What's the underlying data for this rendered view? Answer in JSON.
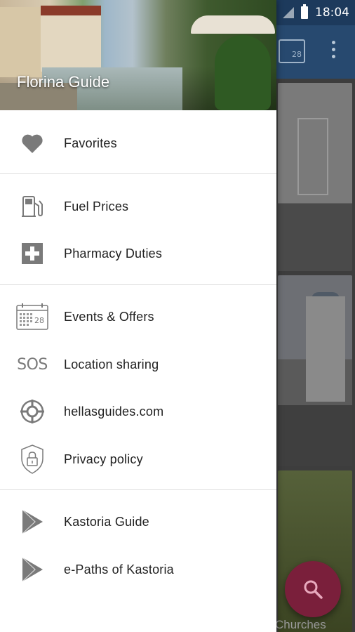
{
  "status_bar": {
    "time": "18:04"
  },
  "background_app": {
    "card_label": "Churches"
  },
  "drawer": {
    "header_title": "Florina Guide",
    "sections": [
      {
        "items": [
          {
            "label": "Favorites",
            "icon": "heart-icon"
          }
        ]
      },
      {
        "items": [
          {
            "label": "Fuel Prices",
            "icon": "fuel-pump-icon"
          },
          {
            "label": "Pharmacy Duties",
            "icon": "pharmacy-cross-icon"
          }
        ]
      },
      {
        "items": [
          {
            "label": "Events & Offers",
            "icon": "calendar-icon"
          },
          {
            "label": "Location sharing",
            "icon": "sos-icon",
            "icon_text": "SOS"
          },
          {
            "label": "hellasguides.com",
            "icon": "crosshair-icon"
          },
          {
            "label": "Privacy policy",
            "icon": "shield-lock-icon"
          }
        ]
      },
      {
        "items": [
          {
            "label": "Kastoria Guide",
            "icon": "play-store-icon"
          },
          {
            "label": "e-Paths of Kastoria",
            "icon": "play-store-icon"
          }
        ]
      }
    ],
    "calendar_icon_day": "28"
  },
  "colors": {
    "drawer_bg": "#ffffff",
    "icon_gray": "#7a7a7a",
    "text_primary": "#212121",
    "fab": "#7a1f3b",
    "appbar": "#27496f"
  }
}
